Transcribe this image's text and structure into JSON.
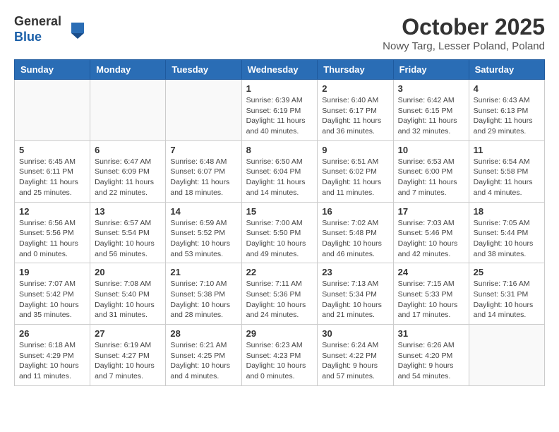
{
  "header": {
    "logo_general": "General",
    "logo_blue": "Blue",
    "month": "October 2025",
    "location": "Nowy Targ, Lesser Poland, Poland"
  },
  "days_of_week": [
    "Sunday",
    "Monday",
    "Tuesday",
    "Wednesday",
    "Thursday",
    "Friday",
    "Saturday"
  ],
  "weeks": [
    [
      {
        "day": "",
        "info": ""
      },
      {
        "day": "",
        "info": ""
      },
      {
        "day": "",
        "info": ""
      },
      {
        "day": "1",
        "info": "Sunrise: 6:39 AM\nSunset: 6:19 PM\nDaylight: 11 hours\nand 40 minutes."
      },
      {
        "day": "2",
        "info": "Sunrise: 6:40 AM\nSunset: 6:17 PM\nDaylight: 11 hours\nand 36 minutes."
      },
      {
        "day": "3",
        "info": "Sunrise: 6:42 AM\nSunset: 6:15 PM\nDaylight: 11 hours\nand 32 minutes."
      },
      {
        "day": "4",
        "info": "Sunrise: 6:43 AM\nSunset: 6:13 PM\nDaylight: 11 hours\nand 29 minutes."
      }
    ],
    [
      {
        "day": "5",
        "info": "Sunrise: 6:45 AM\nSunset: 6:11 PM\nDaylight: 11 hours\nand 25 minutes."
      },
      {
        "day": "6",
        "info": "Sunrise: 6:47 AM\nSunset: 6:09 PM\nDaylight: 11 hours\nand 22 minutes."
      },
      {
        "day": "7",
        "info": "Sunrise: 6:48 AM\nSunset: 6:07 PM\nDaylight: 11 hours\nand 18 minutes."
      },
      {
        "day": "8",
        "info": "Sunrise: 6:50 AM\nSunset: 6:04 PM\nDaylight: 11 hours\nand 14 minutes."
      },
      {
        "day": "9",
        "info": "Sunrise: 6:51 AM\nSunset: 6:02 PM\nDaylight: 11 hours\nand 11 minutes."
      },
      {
        "day": "10",
        "info": "Sunrise: 6:53 AM\nSunset: 6:00 PM\nDaylight: 11 hours\nand 7 minutes."
      },
      {
        "day": "11",
        "info": "Sunrise: 6:54 AM\nSunset: 5:58 PM\nDaylight: 11 hours\nand 4 minutes."
      }
    ],
    [
      {
        "day": "12",
        "info": "Sunrise: 6:56 AM\nSunset: 5:56 PM\nDaylight: 11 hours\nand 0 minutes."
      },
      {
        "day": "13",
        "info": "Sunrise: 6:57 AM\nSunset: 5:54 PM\nDaylight: 10 hours\nand 56 minutes."
      },
      {
        "day": "14",
        "info": "Sunrise: 6:59 AM\nSunset: 5:52 PM\nDaylight: 10 hours\nand 53 minutes."
      },
      {
        "day": "15",
        "info": "Sunrise: 7:00 AM\nSunset: 5:50 PM\nDaylight: 10 hours\nand 49 minutes."
      },
      {
        "day": "16",
        "info": "Sunrise: 7:02 AM\nSunset: 5:48 PM\nDaylight: 10 hours\nand 46 minutes."
      },
      {
        "day": "17",
        "info": "Sunrise: 7:03 AM\nSunset: 5:46 PM\nDaylight: 10 hours\nand 42 minutes."
      },
      {
        "day": "18",
        "info": "Sunrise: 7:05 AM\nSunset: 5:44 PM\nDaylight: 10 hours\nand 38 minutes."
      }
    ],
    [
      {
        "day": "19",
        "info": "Sunrise: 7:07 AM\nSunset: 5:42 PM\nDaylight: 10 hours\nand 35 minutes."
      },
      {
        "day": "20",
        "info": "Sunrise: 7:08 AM\nSunset: 5:40 PM\nDaylight: 10 hours\nand 31 minutes."
      },
      {
        "day": "21",
        "info": "Sunrise: 7:10 AM\nSunset: 5:38 PM\nDaylight: 10 hours\nand 28 minutes."
      },
      {
        "day": "22",
        "info": "Sunrise: 7:11 AM\nSunset: 5:36 PM\nDaylight: 10 hours\nand 24 minutes."
      },
      {
        "day": "23",
        "info": "Sunrise: 7:13 AM\nSunset: 5:34 PM\nDaylight: 10 hours\nand 21 minutes."
      },
      {
        "day": "24",
        "info": "Sunrise: 7:15 AM\nSunset: 5:33 PM\nDaylight: 10 hours\nand 17 minutes."
      },
      {
        "day": "25",
        "info": "Sunrise: 7:16 AM\nSunset: 5:31 PM\nDaylight: 10 hours\nand 14 minutes."
      }
    ],
    [
      {
        "day": "26",
        "info": "Sunrise: 6:18 AM\nSunset: 4:29 PM\nDaylight: 10 hours\nand 11 minutes."
      },
      {
        "day": "27",
        "info": "Sunrise: 6:19 AM\nSunset: 4:27 PM\nDaylight: 10 hours\nand 7 minutes."
      },
      {
        "day": "28",
        "info": "Sunrise: 6:21 AM\nSunset: 4:25 PM\nDaylight: 10 hours\nand 4 minutes."
      },
      {
        "day": "29",
        "info": "Sunrise: 6:23 AM\nSunset: 4:23 PM\nDaylight: 10 hours\nand 0 minutes."
      },
      {
        "day": "30",
        "info": "Sunrise: 6:24 AM\nSunset: 4:22 PM\nDaylight: 9 hours\nand 57 minutes."
      },
      {
        "day": "31",
        "info": "Sunrise: 6:26 AM\nSunset: 4:20 PM\nDaylight: 9 hours\nand 54 minutes."
      },
      {
        "day": "",
        "info": ""
      }
    ]
  ]
}
